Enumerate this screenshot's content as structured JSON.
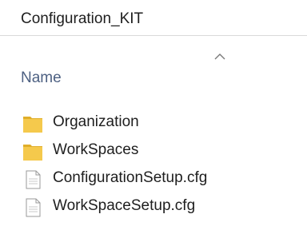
{
  "breadcrumb": {
    "text": "Configuration_KIT"
  },
  "header": {
    "name_column": "Name",
    "sort_icon": "sort-ascending-icon"
  },
  "items": [
    {
      "name": "Organization",
      "type": "folder"
    },
    {
      "name": "WorkSpaces",
      "type": "folder"
    },
    {
      "name": "ConfigurationSetup.cfg",
      "type": "file"
    },
    {
      "name": "WorkSpaceSetup.cfg",
      "type": "file"
    }
  ],
  "colors": {
    "folder": "#f5c94c",
    "folder_dark": "#e0ae2a",
    "header_text": "#4d6082",
    "file_border": "#9a9a9a"
  }
}
